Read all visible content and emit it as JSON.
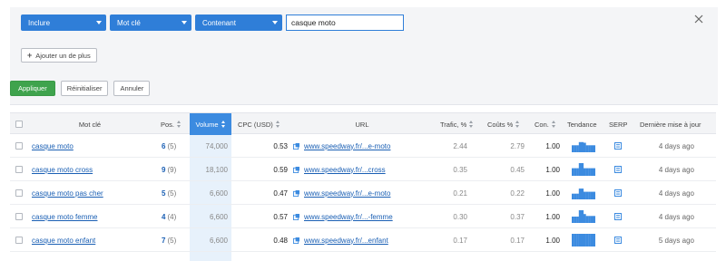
{
  "filters": {
    "include": "Inclure",
    "field": "Mot clé",
    "operator": "Contenant",
    "value": "casque moto",
    "add_label": "Ajouter un de plus"
  },
  "actions": {
    "apply": "Appliquer",
    "reset": "Réinitialiser",
    "cancel": "Annuler"
  },
  "columns": {
    "keyword": "Mot clé",
    "pos": "Pos.",
    "volume": "Volume",
    "cpc": "CPC (USD)",
    "url": "URL",
    "traffic": "Trafic, %",
    "costs": "Coûts %",
    "comp": "Con.",
    "trend": "Tendance",
    "serp": "SERP",
    "updated": "Dernière mise à jour"
  },
  "rows": [
    {
      "keyword": "casque moto",
      "pos": "6",
      "prev": "(5)",
      "volume": "74,000",
      "cpc": "0.53",
      "url": "www.speedway.fr/...e-moto",
      "traffic": "2.44",
      "costs": "2.79",
      "comp": "1.00",
      "trend": [
        0.55,
        0.55,
        0.55,
        0.8,
        0.8,
        0.75,
        0.55,
        0.55,
        0.55,
        0.55
      ],
      "updated": "4 days ago"
    },
    {
      "keyword": "casque moto cross",
      "pos": "9",
      "prev": "(9)",
      "volume": "18,100",
      "cpc": "0.59",
      "url": "www.speedway.fr/...cross",
      "traffic": "0.35",
      "costs": "0.45",
      "comp": "1.00",
      "trend": [
        0.6,
        0.6,
        0.6,
        1.0,
        1.0,
        0.6,
        0.6,
        0.6,
        0.6,
        0.6
      ],
      "updated": "4 days ago"
    },
    {
      "keyword": "casque moto pas cher",
      "pos": "5",
      "prev": "(5)",
      "volume": "6,600",
      "cpc": "0.47",
      "url": "www.speedway.fr/...e-moto",
      "traffic": "0.21",
      "costs": "0.22",
      "comp": "1.00",
      "trend": [
        0.45,
        0.45,
        0.45,
        0.85,
        0.85,
        0.6,
        0.6,
        0.6,
        0.6,
        0.6
      ],
      "updated": "4 days ago"
    },
    {
      "keyword": "casque moto femme",
      "pos": "4",
      "prev": "(4)",
      "volume": "6,600",
      "cpc": "0.57",
      "url": "www.speedway.fr/...-femme",
      "traffic": "0.30",
      "costs": "0.37",
      "comp": "1.00",
      "trend": [
        0.5,
        0.5,
        0.5,
        1.0,
        1.0,
        0.7,
        0.55,
        0.55,
        0.55,
        0.55
      ],
      "updated": "4 days ago"
    },
    {
      "keyword": "casque moto enfant",
      "pos": "7",
      "prev": "(5)",
      "volume": "6,600",
      "cpc": "0.48",
      "url": "www.speedway.fr/...enfant",
      "traffic": "0.17",
      "costs": "0.17",
      "comp": "1.00",
      "trend": [
        1.0,
        1.0,
        1.0,
        1.0,
        1.0,
        1.0,
        1.0,
        1.0,
        1.0,
        1.0
      ],
      "updated": "5 days ago"
    }
  ],
  "colors": {
    "accent": "#2f7ed8",
    "apply": "#3fa34d",
    "link": "#1a5fb4",
    "trend_bar": "#3c8be0",
    "volume_column": "#e7f1fb"
  },
  "icons": [
    "chevron-down-icon",
    "close-icon",
    "plus-icon",
    "checkbox-icon",
    "sort-icon",
    "external-link-icon",
    "serp-icon"
  ]
}
